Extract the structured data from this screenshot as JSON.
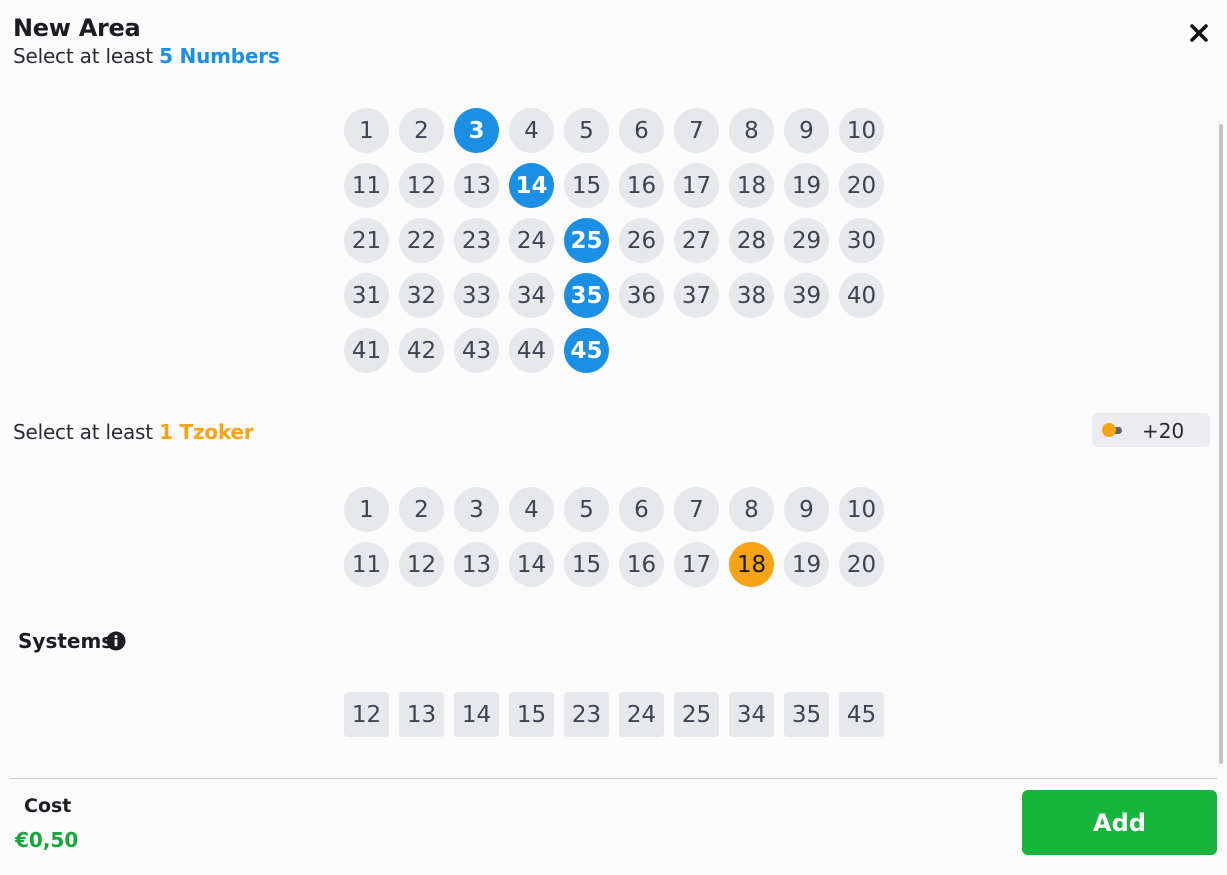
{
  "header": {
    "title": "New Area",
    "close_icon": "close-icon"
  },
  "numbers_section": {
    "prompt_prefix": "Select at least ",
    "prompt_highlight": "5 Numbers",
    "highlight_color": "#1a8fe3",
    "balls": [
      "1",
      "2",
      "3",
      "4",
      "5",
      "6",
      "7",
      "8",
      "9",
      "10",
      "11",
      "12",
      "13",
      "14",
      "15",
      "16",
      "17",
      "18",
      "19",
      "20",
      "21",
      "22",
      "23",
      "24",
      "25",
      "26",
      "27",
      "28",
      "29",
      "30",
      "31",
      "32",
      "33",
      "34",
      "35",
      "36",
      "37",
      "38",
      "39",
      "40",
      "41",
      "42",
      "43",
      "44",
      "45"
    ],
    "selected": [
      "3",
      "14",
      "25",
      "35",
      "45"
    ]
  },
  "tzoker_section": {
    "prompt_prefix": "Select at least ",
    "prompt_highlight": "1 Tzoker",
    "highlight_color": "#f6a316",
    "toggle_label": "+20",
    "toggle_on": false,
    "balls": [
      "1",
      "2",
      "3",
      "4",
      "5",
      "6",
      "7",
      "8",
      "9",
      "10",
      "11",
      "12",
      "13",
      "14",
      "15",
      "16",
      "17",
      "18",
      "19",
      "20"
    ],
    "selected": [
      "18"
    ]
  },
  "systems_section": {
    "label": "Systems",
    "info_icon": "info-icon",
    "options": [
      "12",
      "13",
      "14",
      "15",
      "23",
      "24",
      "25",
      "34",
      "35",
      "45"
    ]
  },
  "footer": {
    "cost_label": "Cost",
    "cost_value": "€0,50",
    "add_label": "Add",
    "add_color": "#17b43c"
  }
}
